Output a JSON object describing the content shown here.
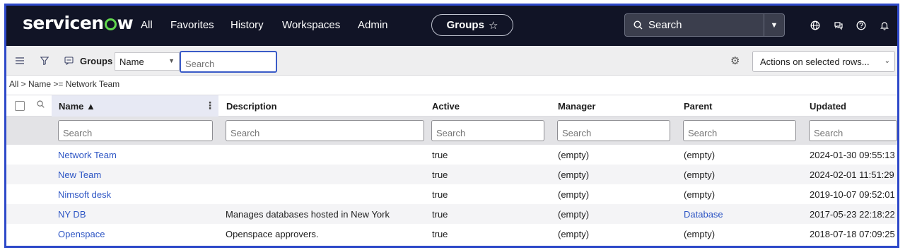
{
  "topnav": {
    "logo": "servicenow",
    "items": [
      "All",
      "Favorites",
      "History",
      "Workspaces",
      "Admin"
    ],
    "context_pill": "Groups",
    "search_label": "Search",
    "accent": "#62d84e",
    "icons": [
      "globe-icon",
      "chat-icon",
      "help-icon",
      "bell-icon"
    ]
  },
  "toolbar": {
    "list_title": "Groups",
    "field_select": "Name",
    "search_placeholder": "Search",
    "actions_select": "Actions on selected rows..."
  },
  "breadcrumb": "All > Name >= Network Team",
  "table": {
    "columns": [
      "Name ▲",
      "Description",
      "Active",
      "Manager",
      "Parent",
      "Updated"
    ],
    "filter_placeholder": "Search",
    "rows": [
      {
        "name": "Network Team",
        "description": "",
        "active": "true",
        "manager": "(empty)",
        "parent": "(empty)",
        "updated": "2024-01-30 09:55:13"
      },
      {
        "name": "New Team",
        "description": "",
        "active": "true",
        "manager": "(empty)",
        "parent": "(empty)",
        "updated": "2024-02-01 11:51:29"
      },
      {
        "name": "Nimsoft desk",
        "description": "",
        "active": "true",
        "manager": "(empty)",
        "parent": "(empty)",
        "updated": "2019-10-07 09:52:01"
      },
      {
        "name": "NY DB",
        "description": "Manages databases hosted in New York",
        "active": "true",
        "manager": "(empty)",
        "parent": "Database",
        "updated": "2017-05-23 22:18:22"
      },
      {
        "name": "Openspace",
        "description": "Openspace approvers.",
        "active": "true",
        "manager": "(empty)",
        "parent": "(empty)",
        "updated": "2018-07-18 07:09:25"
      }
    ]
  }
}
